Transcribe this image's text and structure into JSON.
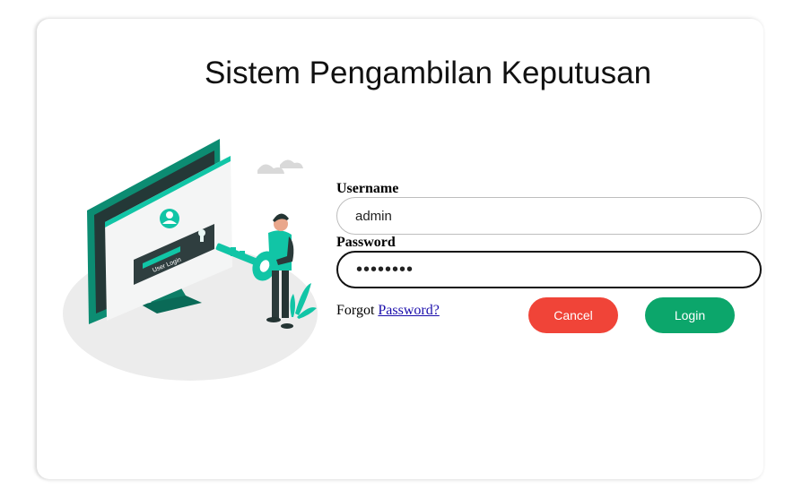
{
  "page": {
    "title": "Sistem Pengambilan Keputusan"
  },
  "illustration": {
    "screen_text": "User Login",
    "accent_color": "#11c5a6"
  },
  "form": {
    "username_label": "Username",
    "username_value": "admin",
    "password_label": "Password",
    "password_value": "••••••••",
    "forgot_prefix": "Forgot ",
    "forgot_link": "Password?",
    "cancel_label": "Cancel",
    "login_label": "Login"
  },
  "colors": {
    "cancel": "#f04438",
    "login": "#0ca66b",
    "link": "#1a0dab"
  }
}
